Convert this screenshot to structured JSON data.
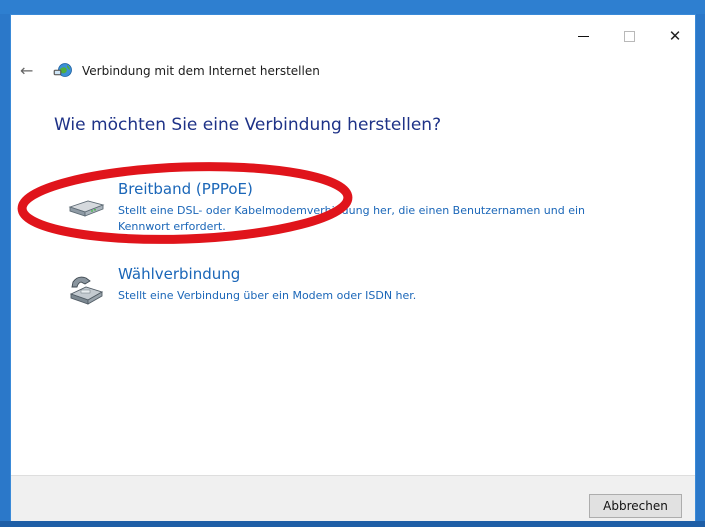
{
  "window": {
    "title": "Verbindung mit dem Internet herstellen",
    "back_icon": "back-arrow-icon",
    "close_symbol": "✕"
  },
  "main": {
    "heading": "Wie möchten Sie eine Verbindung herstellen?",
    "options": [
      {
        "icon": "broadband-modem-icon",
        "title": "Breitband (PPPoE)",
        "description": "Stellt eine DSL- oder Kabelmodemverbindung her, die einen Benutzernamen und ein Kennwort erfordert."
      },
      {
        "icon": "dialup-phone-icon",
        "title": "Wählverbindung",
        "description": "Stellt eine Verbindung über ein Modem oder ISDN her."
      }
    ]
  },
  "footer": {
    "cancel_label": "Abbrechen"
  },
  "colors": {
    "link_blue": "#1a66b8",
    "heading_blue": "#1e3287",
    "annotation_red": "#e0141b"
  }
}
